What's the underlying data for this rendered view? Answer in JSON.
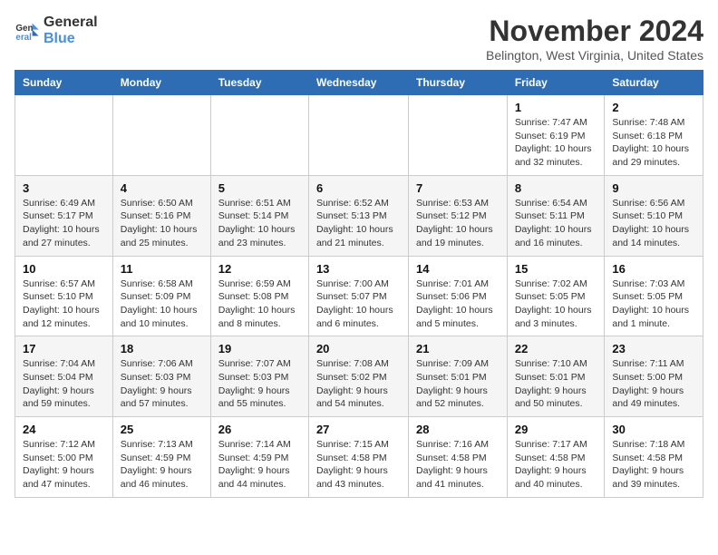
{
  "logo": {
    "line1": "General",
    "line2": "Blue"
  },
  "title": "November 2024",
  "location": "Belington, West Virginia, United States",
  "days_of_week": [
    "Sunday",
    "Monday",
    "Tuesday",
    "Wednesday",
    "Thursday",
    "Friday",
    "Saturday"
  ],
  "weeks": [
    [
      {
        "day": "",
        "info": ""
      },
      {
        "day": "",
        "info": ""
      },
      {
        "day": "",
        "info": ""
      },
      {
        "day": "",
        "info": ""
      },
      {
        "day": "",
        "info": ""
      },
      {
        "day": "1",
        "info": "Sunrise: 7:47 AM\nSunset: 6:19 PM\nDaylight: 10 hours and 32 minutes."
      },
      {
        "day": "2",
        "info": "Sunrise: 7:48 AM\nSunset: 6:18 PM\nDaylight: 10 hours and 29 minutes."
      }
    ],
    [
      {
        "day": "3",
        "info": "Sunrise: 6:49 AM\nSunset: 5:17 PM\nDaylight: 10 hours and 27 minutes."
      },
      {
        "day": "4",
        "info": "Sunrise: 6:50 AM\nSunset: 5:16 PM\nDaylight: 10 hours and 25 minutes."
      },
      {
        "day": "5",
        "info": "Sunrise: 6:51 AM\nSunset: 5:14 PM\nDaylight: 10 hours and 23 minutes."
      },
      {
        "day": "6",
        "info": "Sunrise: 6:52 AM\nSunset: 5:13 PM\nDaylight: 10 hours and 21 minutes."
      },
      {
        "day": "7",
        "info": "Sunrise: 6:53 AM\nSunset: 5:12 PM\nDaylight: 10 hours and 19 minutes."
      },
      {
        "day": "8",
        "info": "Sunrise: 6:54 AM\nSunset: 5:11 PM\nDaylight: 10 hours and 16 minutes."
      },
      {
        "day": "9",
        "info": "Sunrise: 6:56 AM\nSunset: 5:10 PM\nDaylight: 10 hours and 14 minutes."
      }
    ],
    [
      {
        "day": "10",
        "info": "Sunrise: 6:57 AM\nSunset: 5:10 PM\nDaylight: 10 hours and 12 minutes."
      },
      {
        "day": "11",
        "info": "Sunrise: 6:58 AM\nSunset: 5:09 PM\nDaylight: 10 hours and 10 minutes."
      },
      {
        "day": "12",
        "info": "Sunrise: 6:59 AM\nSunset: 5:08 PM\nDaylight: 10 hours and 8 minutes."
      },
      {
        "day": "13",
        "info": "Sunrise: 7:00 AM\nSunset: 5:07 PM\nDaylight: 10 hours and 6 minutes."
      },
      {
        "day": "14",
        "info": "Sunrise: 7:01 AM\nSunset: 5:06 PM\nDaylight: 10 hours and 5 minutes."
      },
      {
        "day": "15",
        "info": "Sunrise: 7:02 AM\nSunset: 5:05 PM\nDaylight: 10 hours and 3 minutes."
      },
      {
        "day": "16",
        "info": "Sunrise: 7:03 AM\nSunset: 5:05 PM\nDaylight: 10 hours and 1 minute."
      }
    ],
    [
      {
        "day": "17",
        "info": "Sunrise: 7:04 AM\nSunset: 5:04 PM\nDaylight: 9 hours and 59 minutes."
      },
      {
        "day": "18",
        "info": "Sunrise: 7:06 AM\nSunset: 5:03 PM\nDaylight: 9 hours and 57 minutes."
      },
      {
        "day": "19",
        "info": "Sunrise: 7:07 AM\nSunset: 5:03 PM\nDaylight: 9 hours and 55 minutes."
      },
      {
        "day": "20",
        "info": "Sunrise: 7:08 AM\nSunset: 5:02 PM\nDaylight: 9 hours and 54 minutes."
      },
      {
        "day": "21",
        "info": "Sunrise: 7:09 AM\nSunset: 5:01 PM\nDaylight: 9 hours and 52 minutes."
      },
      {
        "day": "22",
        "info": "Sunrise: 7:10 AM\nSunset: 5:01 PM\nDaylight: 9 hours and 50 minutes."
      },
      {
        "day": "23",
        "info": "Sunrise: 7:11 AM\nSunset: 5:00 PM\nDaylight: 9 hours and 49 minutes."
      }
    ],
    [
      {
        "day": "24",
        "info": "Sunrise: 7:12 AM\nSunset: 5:00 PM\nDaylight: 9 hours and 47 minutes."
      },
      {
        "day": "25",
        "info": "Sunrise: 7:13 AM\nSunset: 4:59 PM\nDaylight: 9 hours and 46 minutes."
      },
      {
        "day": "26",
        "info": "Sunrise: 7:14 AM\nSunset: 4:59 PM\nDaylight: 9 hours and 44 minutes."
      },
      {
        "day": "27",
        "info": "Sunrise: 7:15 AM\nSunset: 4:58 PM\nDaylight: 9 hours and 43 minutes."
      },
      {
        "day": "28",
        "info": "Sunrise: 7:16 AM\nSunset: 4:58 PM\nDaylight: 9 hours and 41 minutes."
      },
      {
        "day": "29",
        "info": "Sunrise: 7:17 AM\nSunset: 4:58 PM\nDaylight: 9 hours and 40 minutes."
      },
      {
        "day": "30",
        "info": "Sunrise: 7:18 AM\nSunset: 4:58 PM\nDaylight: 9 hours and 39 minutes."
      }
    ]
  ]
}
